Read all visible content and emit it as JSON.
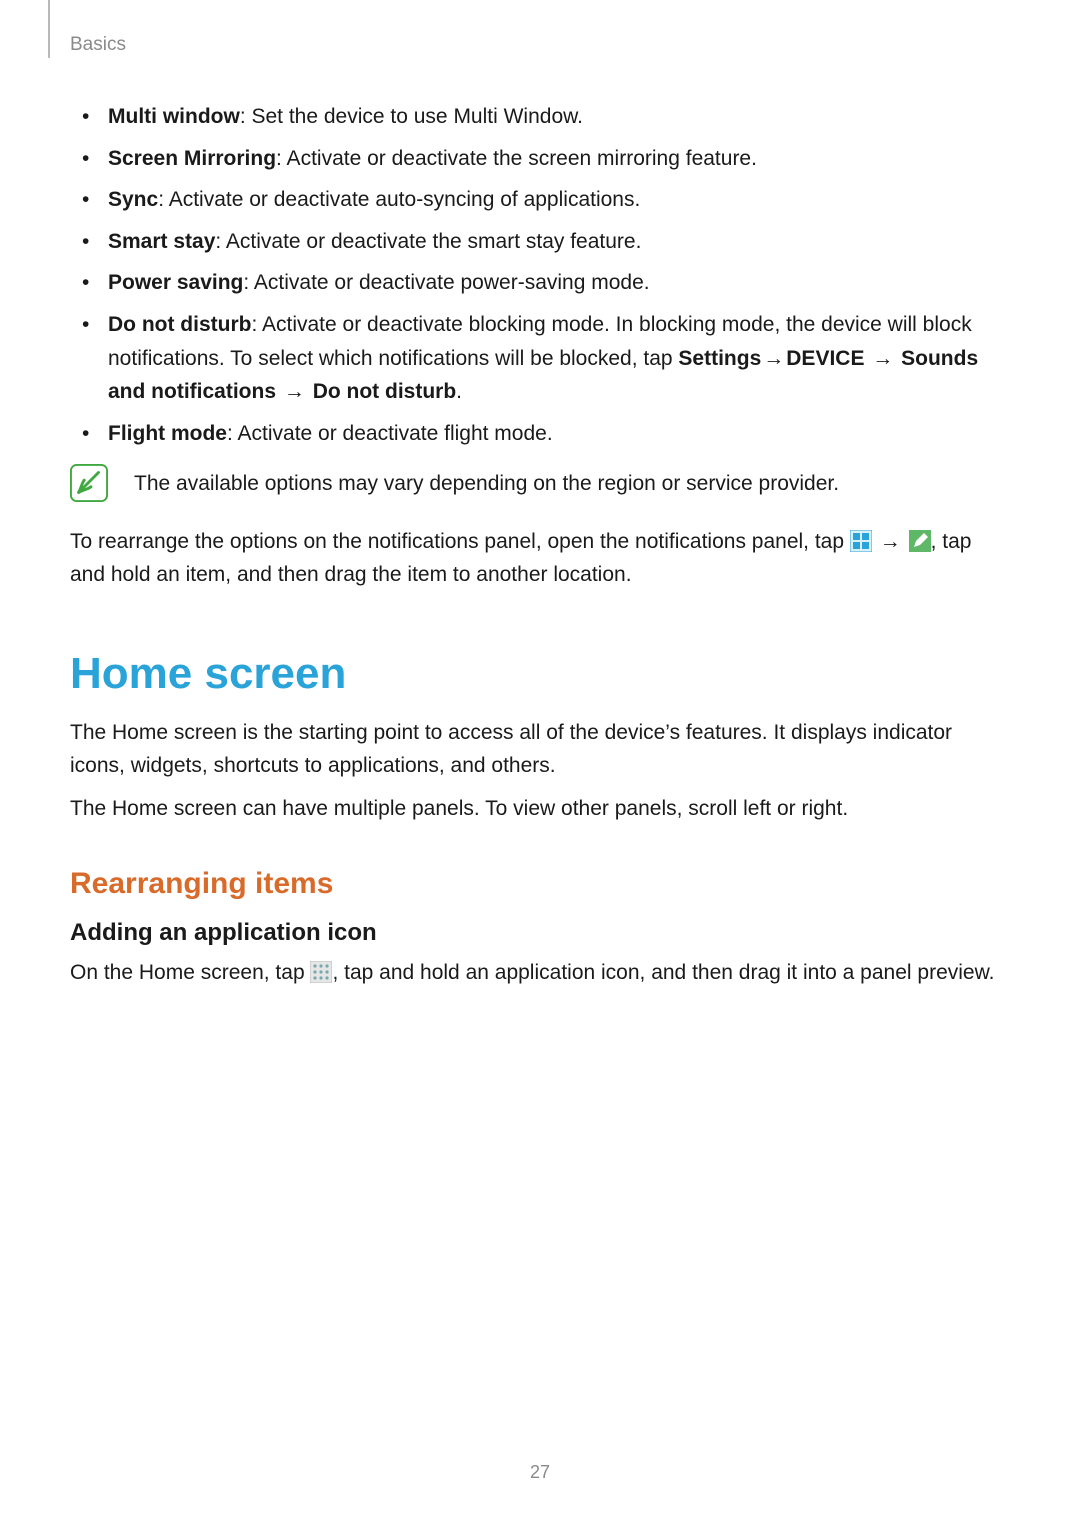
{
  "header": {
    "section": "Basics"
  },
  "bullets": [
    {
      "term": "Multi window",
      "desc": ": Set the device to use Multi Window."
    },
    {
      "term": "Screen Mirroring",
      "desc": ": Activate or deactivate the screen mirroring feature."
    },
    {
      "term": "Sync",
      "desc": ": Activate or deactivate auto-syncing of applications."
    },
    {
      "term": "Smart stay",
      "desc": ": Activate or deactivate the smart stay feature."
    },
    {
      "term": "Power saving",
      "desc": ": Activate or deactivate power-saving mode."
    }
  ],
  "dnd": {
    "term": "Do not disturb",
    "lead": ": Activate or deactivate blocking mode. In blocking mode, the device will block notifications. To select which notifications will be blocked, tap ",
    "path1": "Settings",
    "arrow": "→",
    "path2": "DEVICE",
    "path3": "Sounds and notifications",
    "path4": "Do not disturb",
    "tail": "."
  },
  "flight": {
    "term": "Flight mode",
    "desc": ": Activate or deactivate flight mode."
  },
  "note": "The available options may vary depending on the region or service provider.",
  "rearrange": {
    "pre": "To rearrange the options on the notifications panel, open the notifications panel, tap ",
    "arrow": "→",
    "post": ", tap and hold an item, and then drag the item to another location."
  },
  "h1": "Home screen",
  "home_p1": "The Home screen is the starting point to access all of the device’s features. It displays indicator icons, widgets, shortcuts to applications, and others.",
  "home_p2": "The Home screen can have multiple panels. To view other panels, scroll left or right.",
  "h2": "Rearranging items",
  "h3": "Adding an application icon",
  "add_icon": {
    "pre": "On the Home screen, tap ",
    "post": ", tap and hold an application icon, and then drag it into a panel preview."
  },
  "page": "27"
}
